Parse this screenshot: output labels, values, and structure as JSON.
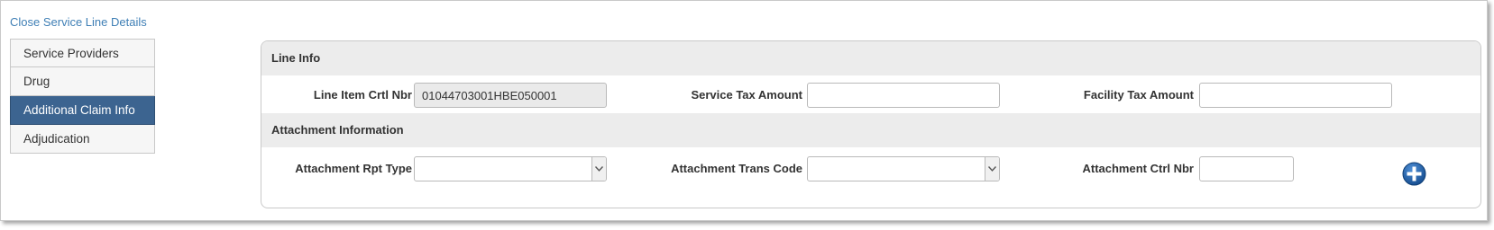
{
  "close_link": "Close Service Line Details",
  "tabs": [
    {
      "label": "Service Providers"
    },
    {
      "label": "Drug"
    },
    {
      "label": "Additional Claim Info"
    },
    {
      "label": "Adjudication"
    }
  ],
  "active_tab": "Additional Claim Info",
  "line_info": {
    "title": "Line Info",
    "line_item_label": "Line Item Crtl Nbr",
    "line_item_value": "01044703001HBE050001",
    "service_tax_label": "Service Tax Amount",
    "service_tax_value": "",
    "facility_tax_label": "Facility Tax Amount",
    "facility_tax_value": ""
  },
  "attachment": {
    "title": "Attachment Information",
    "rpt_type_label": "Attachment Rpt Type",
    "rpt_type_value": "",
    "trans_code_label": "Attachment Trans Code",
    "trans_code_value": "",
    "ctrl_nbr_label": "Attachment Ctrl Nbr",
    "ctrl_nbr_value": ""
  },
  "icons": {
    "dropdown": "chevron-down-icon",
    "add": "plus-circle-icon"
  },
  "colors": {
    "link": "#3f7fb5",
    "active_tab": "#3c6490",
    "add_button": "#1f5fa8"
  }
}
